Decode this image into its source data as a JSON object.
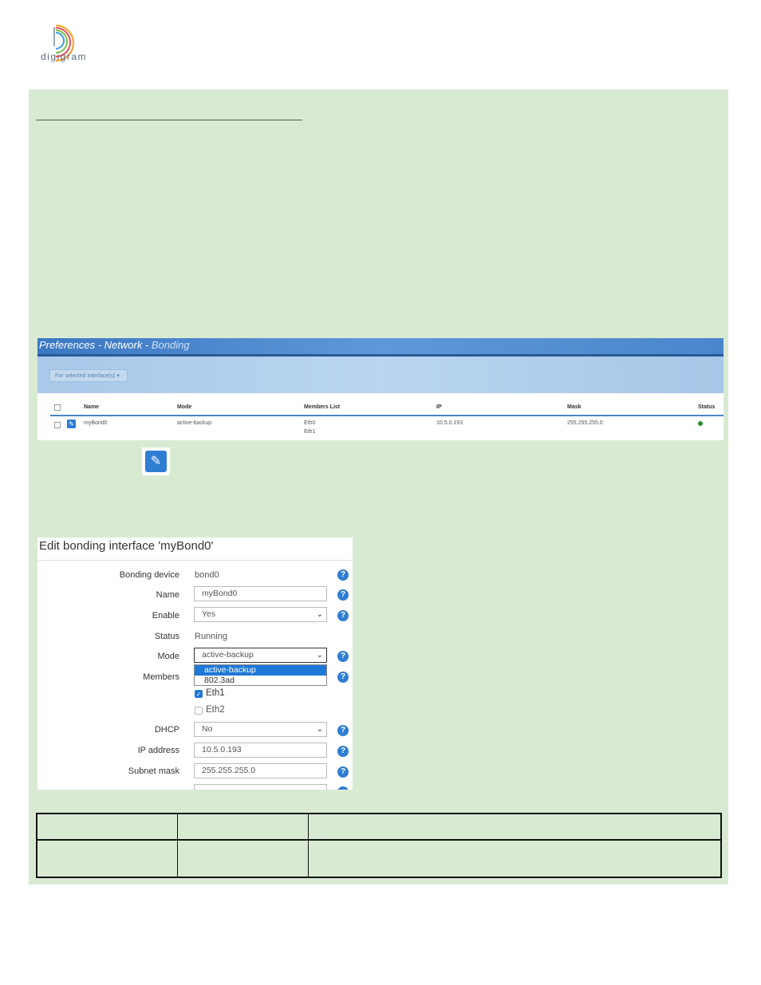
{
  "logo": {
    "wordmark": "digigram",
    "icon": "digigram-logo-icon"
  },
  "bonding_screenshot": {
    "title_prefix": "Preferences - Network - ",
    "title_current": "Bonding",
    "bulk_action": "For selected interface(s) ▾",
    "columns": [
      "Name",
      "Mode",
      "Members List",
      "IP",
      "Mask",
      "Status"
    ],
    "row": {
      "name": "myBond0",
      "mode": "active-backup",
      "member1": "Eth0",
      "member2": "Eth1",
      "ip": "10.5.0.193",
      "mask": "255.255.255.0",
      "status_color": "#2e8b2e"
    }
  },
  "edit_icon": "pencil-icon",
  "form": {
    "title": "Edit bonding interface 'myBond0'",
    "bonding_device_label": "Bonding device",
    "bonding_device_value": "bond0",
    "name_label": "Name",
    "name_value": "myBond0",
    "enable_label": "Enable",
    "enable_value": "Yes",
    "status_label": "Status",
    "status_value": "Running",
    "mode_label": "Mode",
    "mode_value": "active-backup",
    "mode_options": [
      "active-backup",
      "802.3ad"
    ],
    "members_label": "Members",
    "member_eth1": "Eth1",
    "member_eth2": "Eth2",
    "dhcp_label": "DHCP",
    "dhcp_value": "No",
    "ip_label": "IP address",
    "ip_value": "10.5.0.193",
    "mask_label": "Subnet mask",
    "mask_value": "255.255.255.0",
    "help_glyph": "?",
    "chevron": "⌄"
  },
  "colors": {
    "panel_bg": "#d9ead3",
    "accent": "#2f7ed2",
    "selected_option": "#1e78d8"
  }
}
